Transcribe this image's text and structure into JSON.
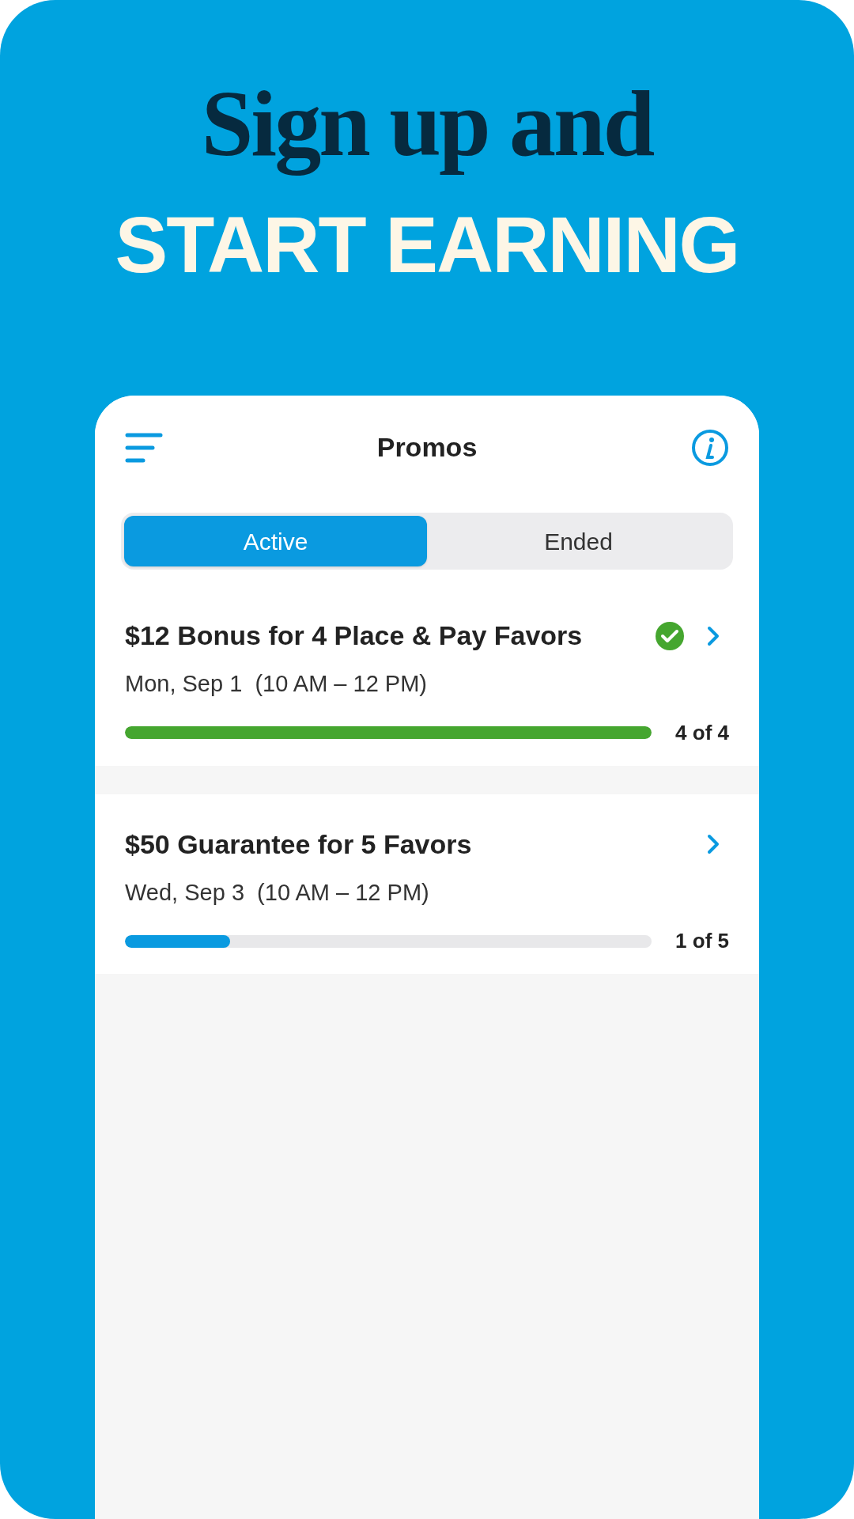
{
  "headline": {
    "line_1": "Sign up and",
    "line_2": "START EARNING"
  },
  "header": {
    "title": "Promos"
  },
  "tabs": [
    {
      "label": "Active",
      "selected": true
    },
    {
      "label": "Ended",
      "selected": false
    }
  ],
  "promos": [
    {
      "title": "$12 Bonus for 4 Place & Pay Favors",
      "date": "Mon, Sep 1  (10 AM – 12 PM)",
      "completed": true,
      "level": 1,
      "progress": "4 of 4"
    },
    {
      "title": "$50 Guarantee for 5 Favors",
      "date": "Wed, Sep 3  (10 AM – 12 PM)",
      "completed": false,
      "level": 0.2,
      "progress": "1 of 5"
    }
  ]
}
